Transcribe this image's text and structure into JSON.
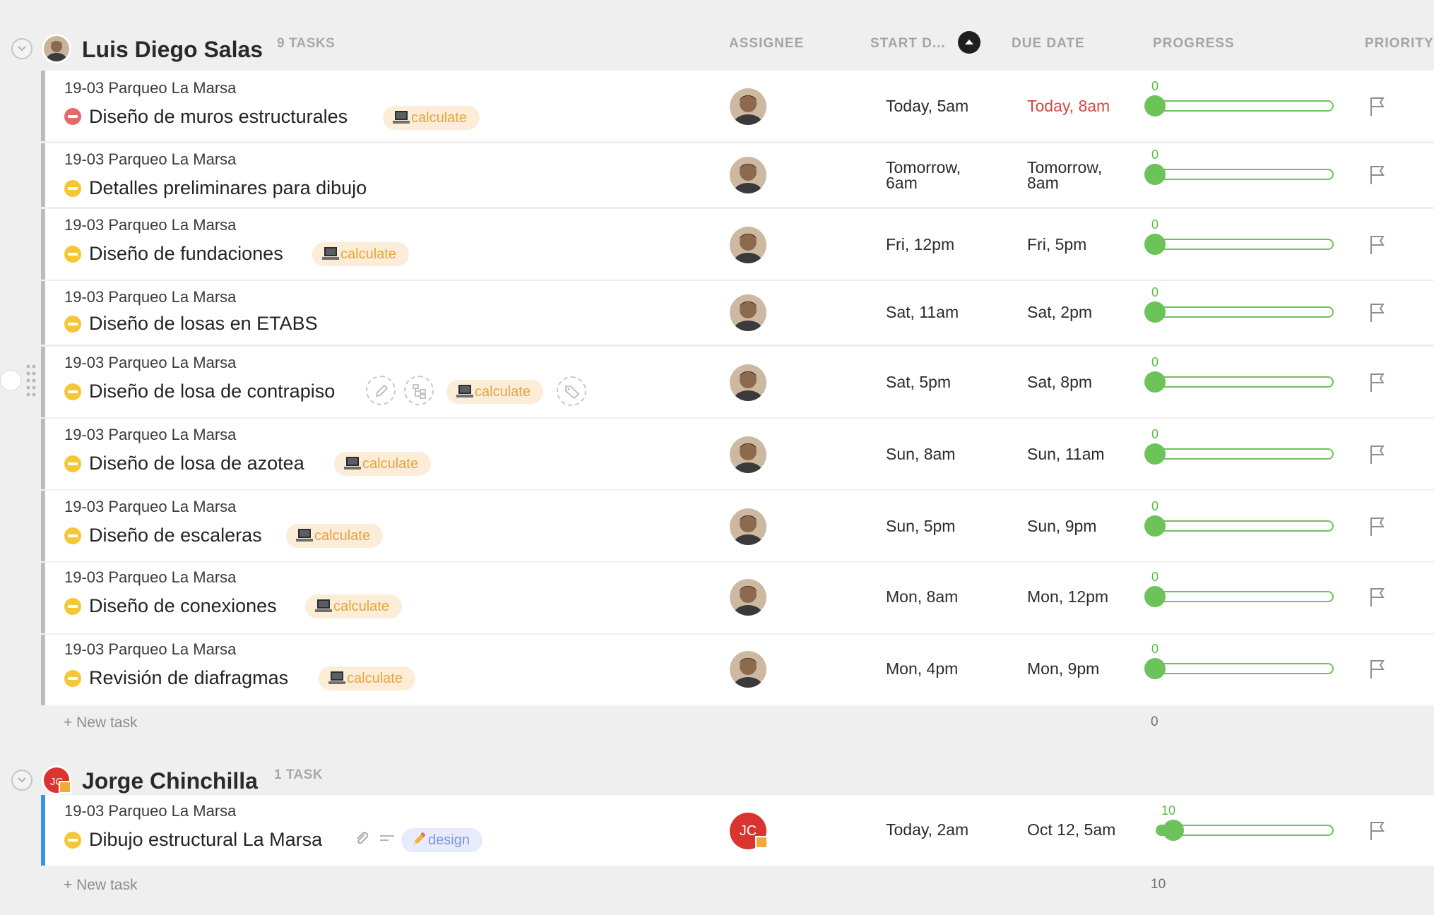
{
  "columns": {
    "assignee": "ASSIGNEE",
    "start_date": "START D...",
    "due_date": "DUE DATE",
    "progress": "PROGRESS",
    "priority": "PRIORITY"
  },
  "groups": [
    {
      "name": "Luis Diego Salas",
      "count": "9 TASKS",
      "new_task": "+ New task",
      "progress_total": "0",
      "tasks": [
        {
          "project": "19-03 Parqueo La Marsa",
          "name": "Diseño de muros estructurales",
          "status": "red",
          "tag": "calculate",
          "start": "Today, 5am",
          "due": "Today, 8am",
          "due_overdue": true,
          "progress": "0"
        },
        {
          "project": "19-03 Parqueo La Marsa",
          "name": "Detalles preliminares para dibujo",
          "status": "yellow",
          "tag": "",
          "start": "Tomorrow, 6am",
          "due": "Tomorrow, 8am",
          "progress": "0"
        },
        {
          "project": "19-03 Parqueo La Marsa",
          "name": "Diseño de fundaciones",
          "status": "yellow",
          "tag": "calculate",
          "start": "Fri, 12pm",
          "due": "Fri, 5pm",
          "progress": "0"
        },
        {
          "project": "19-03 Parqueo La Marsa",
          "name": "Diseño de losas en ETABS",
          "status": "yellow",
          "tag": "",
          "start": "Sat, 11am",
          "due": "Sat, 2pm",
          "progress": "0"
        },
        {
          "project": "19-03 Parqueo La Marsa",
          "name": "Diseño de losa de contrapiso",
          "status": "yellow",
          "tag": "calculate",
          "start": "Sat, 5pm",
          "due": "Sat, 8pm",
          "progress": "0"
        },
        {
          "project": "19-03 Parqueo La Marsa",
          "name": "Diseño de losa de azotea",
          "status": "yellow",
          "tag": "calculate",
          "start": "Sun, 8am",
          "due": "Sun, 11am",
          "progress": "0"
        },
        {
          "project": "19-03 Parqueo La Marsa",
          "name": "Diseño de escaleras",
          "status": "yellow",
          "tag": "calculate",
          "start": "Sun, 5pm",
          "due": "Sun, 9pm",
          "progress": "0"
        },
        {
          "project": "19-03 Parqueo La Marsa",
          "name": "Diseño de conexiones",
          "status": "yellow",
          "tag": "calculate",
          "start": "Mon, 8am",
          "due": "Mon, 12pm",
          "progress": "0"
        },
        {
          "project": "19-03 Parqueo La Marsa",
          "name": "Revisión de diafragmas",
          "status": "yellow",
          "tag": "calculate",
          "start": "Mon, 4pm",
          "due": "Mon, 9pm",
          "progress": "0"
        }
      ]
    },
    {
      "name": "Jorge Chinchilla",
      "count": "1 TASK",
      "initials": "JC",
      "new_task": "+ New task",
      "progress_total": "10",
      "tasks": [
        {
          "project": "19-03 Parqueo La Marsa",
          "name": "Dibujo estructural La Marsa",
          "status": "yellow",
          "tag": "design",
          "start": "Today, 2am",
          "due": "Oct 12, 5am",
          "progress": "10"
        }
      ]
    }
  ],
  "progress_levels": {
    "luis_tasks": 0,
    "jorge_task": 10
  },
  "colors": {
    "accent_green": "#6cc35a",
    "overdue_red": "#d24a3f",
    "tag_calculate": "#e8a53a",
    "tag_design": "#7f97d6",
    "status_yellow": "#f4c737",
    "status_red": "#e16b6b",
    "group_bar_blue": "#3e8ee8"
  },
  "icons": [
    "collapse-chevron-icon",
    "laptop-icon",
    "pencil-icon",
    "subtask-icon",
    "tag-icon",
    "paperclip-icon",
    "description-icon",
    "flag-icon",
    "sort-up-icon",
    "drag-handle-icon"
  ]
}
